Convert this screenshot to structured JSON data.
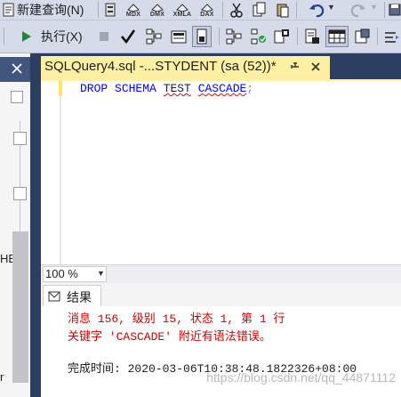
{
  "menu": {
    "new_query_label": "新建查询(N)"
  },
  "toolbar1": {
    "mdx_label": "MDX",
    "dmx_label": "DMX",
    "xmla_label": "XMLA",
    "dax_label": "DAX"
  },
  "toolbar2": {
    "execute_label": "执行(X)"
  },
  "editor": {
    "tab_title": "SQLQuery4.sql -...STYDENT (sa (52))*",
    "code_line": {
      "kw_drop": "DROP",
      "kw_schema": "SCHEMA",
      "ident": "TEST",
      "kw_cascade": "CASCADE",
      "semicolon": ";"
    }
  },
  "zoom": {
    "value": "100 %"
  },
  "results": {
    "tab_label": "结果",
    "message_line1": "消息 156, 级别 15, 状态 1, 第 1 行",
    "message_line2": "关键字 'CASCADE' 附近有语法错误。",
    "completion": "完成时间: 2020-03-06T10:38:48.1822326+08:00"
  },
  "left_panel": {
    "partial_text_1": "HE",
    "partial_text_2": "r"
  },
  "watermark": "https://blog.csdn.net/qq_44871112",
  "colors": {
    "tab_active": "#fff0a3",
    "keyword": "#0000ff",
    "error": "#d00000",
    "frame": "#2d3e63"
  }
}
